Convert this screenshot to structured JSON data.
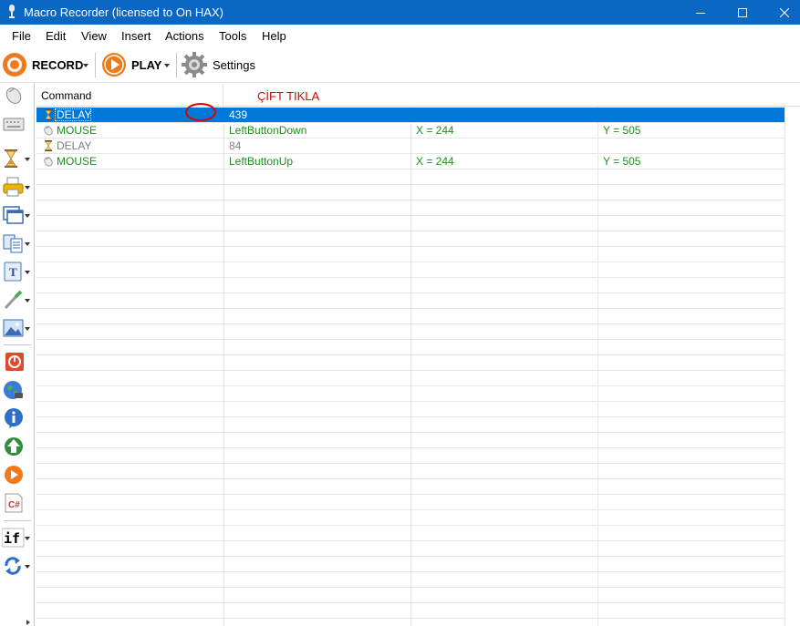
{
  "window": {
    "title": "Macro Recorder (licensed to On HAX)",
    "controls": [
      "minimize",
      "maximize",
      "close"
    ]
  },
  "menu": [
    "File",
    "Edit",
    "View",
    "Insert",
    "Actions",
    "Tools",
    "Help"
  ],
  "toolbar": {
    "record_label": "RECORD",
    "play_label": "PLAY",
    "settings_label": "Settings"
  },
  "sidebar": {
    "tools": [
      "mouse-icon",
      "keyboard-icon",
      "delay-icon",
      "print-icon",
      "window-icon",
      "clipboard-icon",
      "text-icon",
      "color-picker-icon",
      "image-icon",
      "stop-icon",
      "web-icon",
      "info-icon",
      "download-icon",
      "play-icon",
      "csharp-icon",
      "if-icon",
      "loop-icon"
    ]
  },
  "grid": {
    "columns": [
      "Command",
      "",
      "",
      ""
    ],
    "annotation": "ÇİFT TIKLA",
    "rows": [
      {
        "icon": "hourglass-icon",
        "command": "DELAY",
        "value": "439",
        "x": "",
        "y": "",
        "selected": true,
        "style": "selected"
      },
      {
        "icon": "mouse-icon",
        "command": "MOUSE",
        "value": "LeftButtonDown",
        "x": "X = 244",
        "y": "Y = 505",
        "selected": false,
        "style": "green"
      },
      {
        "icon": "hourglass-icon",
        "command": "DELAY",
        "value": "84",
        "x": "",
        "y": "",
        "selected": false,
        "style": "gray"
      },
      {
        "icon": "mouse-icon",
        "command": "MOUSE",
        "value": "LeftButtonUp",
        "x": "X = 244",
        "y": "Y = 505",
        "selected": false,
        "style": "green"
      }
    ]
  },
  "colors": {
    "titlebar": "#0a67c4",
    "selection": "#0078d7",
    "record": "#f07a1a",
    "green_text": "#1f8f1f",
    "annotation": "#e00000"
  }
}
